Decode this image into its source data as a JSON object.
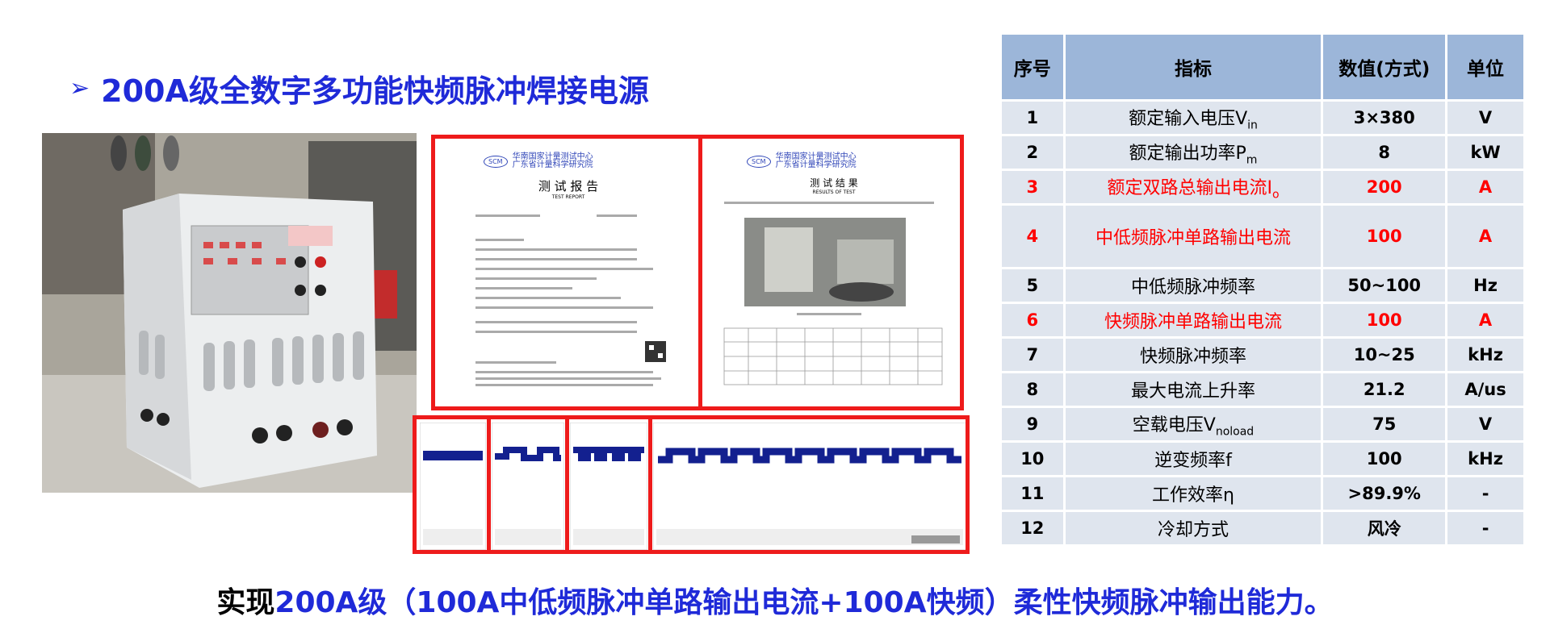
{
  "title": "200A级全数字多功能快频脉冲焊接电源",
  "bullet": "➢",
  "report": {
    "page1_org": "华南国家计量测试中心",
    "page1_org2": "广东省计量科学研究院",
    "page1_heading": "测 试 报 告",
    "page1_sub": "TEST REPORT",
    "page2_org": "华南国家计量测试中心",
    "page2_org2": "广东省计量科学研究院",
    "page2_heading": "测 试 结 果",
    "page2_sub": "RESULTS OF TEST",
    "logo": "SCM"
  },
  "table": {
    "headers": [
      "序号",
      "指标",
      "数值(方式)",
      "单位"
    ],
    "rows": [
      {
        "idx": "1",
        "name": "额定输入电压V",
        "sub": "in",
        "value": "3×380",
        "unit": "V",
        "red": false
      },
      {
        "idx": "2",
        "name": "额定输出功率P",
        "sub": "m",
        "value": "8",
        "unit": "kW",
        "red": false
      },
      {
        "idx": "3",
        "name": "额定双路总输出电流I",
        "sub": "o",
        "value": "200",
        "unit": "A",
        "red": true
      },
      {
        "idx": "4",
        "name": "中低频脉冲单路输出电流",
        "sub": "",
        "value": "100",
        "unit": "A",
        "red": true
      },
      {
        "idx": "5",
        "name": "中低频脉冲频率",
        "sub": "",
        "value": "50~100",
        "unit": "Hz",
        "red": false
      },
      {
        "idx": "6",
        "name": "快频脉冲单路输出电流",
        "sub": "",
        "value": "100",
        "unit": "A",
        "red": true
      },
      {
        "idx": "7",
        "name": "快频脉冲频率",
        "sub": "",
        "value": "10~25",
        "unit": "kHz",
        "red": false
      },
      {
        "idx": "8",
        "name": "最大电流上升率",
        "sub": "",
        "value": "21.2",
        "unit": "A/us",
        "red": false
      },
      {
        "idx": "9",
        "name": "空载电压V",
        "sub": "noload",
        "value": "75",
        "unit": "V",
        "red": false
      },
      {
        "idx": "10",
        "name": "逆变频率f",
        "sub": "",
        "value": "100",
        "unit": "kHz",
        "red": false
      },
      {
        "idx": "11",
        "name": "工作效率η",
        "sub": "",
        "value": ">89.9%",
        "unit": "-",
        "red": false
      },
      {
        "idx": "12",
        "name": "冷却方式",
        "sub": "",
        "value": "风冷",
        "unit": "-",
        "red": false
      }
    ]
  },
  "footer": {
    "part1": "实现",
    "part2": "200A级（100A中低频脉冲单路输出电流+100A快频）柔性快频脉冲输出能力。"
  },
  "colors": {
    "blue": "#1f2ad8",
    "red": "#ff0000",
    "frame": "#ee1b1b",
    "header": "#9cb6d9",
    "cell": "#dfe5ee",
    "wave": "#13208f"
  }
}
